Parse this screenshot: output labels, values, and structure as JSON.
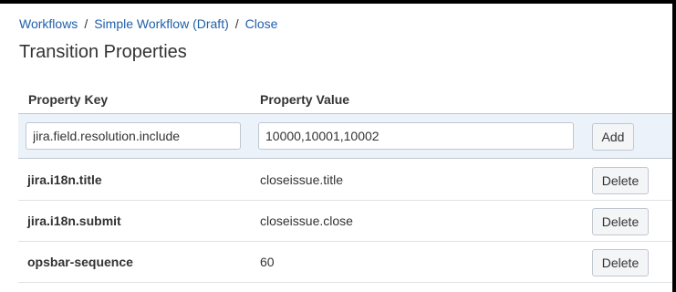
{
  "breadcrumb": {
    "items": [
      "Workflows",
      "Simple Workflow (Draft)",
      "Close"
    ],
    "separator": "/"
  },
  "page": {
    "title": "Transition Properties"
  },
  "table": {
    "headers": {
      "key": "Property Key",
      "value": "Property Value"
    },
    "add_row": {
      "key_value": "jira.field.resolution.include",
      "value_value": "10000,10001,10002",
      "add_label": "Add"
    },
    "rows": [
      {
        "key": "jira.i18n.title",
        "value": "closeissue.title",
        "action": "Delete"
      },
      {
        "key": "jira.i18n.submit",
        "value": "closeissue.close",
        "action": "Delete"
      },
      {
        "key": "opsbar-sequence",
        "value": "60",
        "action": "Delete"
      }
    ]
  },
  "colors": {
    "link": "#1f5fa8",
    "add_row_bg": "#ebf2f9",
    "border": "#c1c7d0",
    "button_bg": "#f4f5f7"
  }
}
